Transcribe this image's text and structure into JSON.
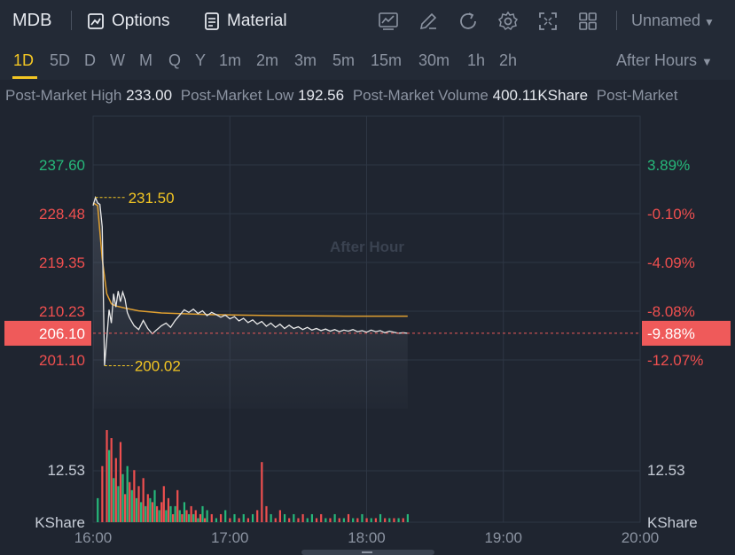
{
  "header": {
    "symbol": "MDB",
    "options_label": "Options",
    "material_label": "Material",
    "layout_name": "Unnamed"
  },
  "periods": {
    "items": [
      "1D",
      "5D",
      "D",
      "W",
      "M",
      "Q",
      "Y",
      "1m",
      "2m",
      "3m",
      "5m",
      "15m",
      "30m",
      "1h",
      "2h"
    ],
    "active": "1D",
    "session": "After Hours"
  },
  "stats": [
    {
      "label": "Post-Market High",
      "value": "233.00"
    },
    {
      "label": "Post-Market Low",
      "value": "192.56"
    },
    {
      "label": "Post-Market Volume",
      "value": "400.11KShare"
    },
    {
      "label": "Post-Market",
      "value": ""
    }
  ],
  "chart_data": {
    "type": "line",
    "watermark": "After Hour",
    "x_ticks": [
      "16:00",
      "17:00",
      "18:00",
      "19:00",
      "20:00"
    ],
    "price_axis": {
      "labels": [
        "237.60",
        "228.48",
        "219.35",
        "210.23",
        "201.10"
      ],
      "values": [
        237.6,
        228.48,
        219.35,
        210.23,
        201.1
      ]
    },
    "pct_axis": {
      "labels": [
        "3.89%",
        "-0.10%",
        "-4.09%",
        "-8.08%",
        "-12.07%"
      ]
    },
    "last_price": "206.10",
    "last_pct": "-9.88%",
    "high_marker": {
      "label": "231.50",
      "value": 231.5
    },
    "low_marker": {
      "label": "200.02",
      "value": 200.02
    },
    "volume_axis": {
      "label": "12.53",
      "unit": "KShare"
    },
    "price_series": {
      "x_minutes": [
        0,
        1,
        2,
        3,
        4,
        5,
        6,
        7,
        8,
        9,
        10,
        11,
        12,
        13,
        14,
        15,
        16,
        18,
        20,
        22,
        24,
        26,
        28,
        30,
        32,
        34,
        36,
        38,
        40,
        42,
        44,
        46,
        48,
        50,
        52,
        54,
        56,
        58,
        60,
        62,
        64,
        66,
        68,
        70,
        72,
        74,
        76,
        78,
        80,
        82,
        84,
        86,
        88,
        90,
        92,
        94,
        96,
        98,
        100,
        102,
        104,
        106,
        108,
        110,
        112,
        114,
        116,
        118,
        120,
        122,
        124,
        126,
        128,
        130,
        132,
        134,
        136,
        138
      ],
      "y_price": [
        230.0,
        231.5,
        230.5,
        230.2,
        226.0,
        200.02,
        205.0,
        210.5,
        208.0,
        213.5,
        211.0,
        214.0,
        212.0,
        213.8,
        212.5,
        210.0,
        209.0,
        207.5,
        206.8,
        208.5,
        207.0,
        206.0,
        206.8,
        207.5,
        208.0,
        207.2,
        208.5,
        209.5,
        210.5,
        210.0,
        210.6,
        209.8,
        210.3,
        209.4,
        210.0,
        209.6,
        209.1,
        209.5,
        208.8,
        209.2,
        208.4,
        208.9,
        208.1,
        208.6,
        207.8,
        208.3,
        207.4,
        208.0,
        207.2,
        207.8,
        207.0,
        207.6,
        207.0,
        207.3,
        206.8,
        207.2,
        206.7,
        207.0,
        206.6,
        206.9,
        206.5,
        206.8,
        206.4,
        206.7,
        206.5,
        206.8,
        206.4,
        206.6,
        206.3,
        206.7,
        206.4,
        206.6,
        206.2,
        206.5,
        206.3,
        206.1,
        206.2,
        206.1
      ]
    },
    "avg_series": {
      "x_minutes": [
        0,
        2,
        4,
        6,
        8,
        10,
        14,
        20,
        30,
        50,
        80,
        110,
        138
      ],
      "y_price": [
        230.5,
        230.0,
        220.0,
        213.5,
        211.6,
        211.2,
        210.8,
        210.3,
        209.9,
        209.6,
        209.4,
        209.3,
        209.3
      ]
    },
    "volume": [
      {
        "m": 2,
        "v": 6,
        "c": "g"
      },
      {
        "m": 4,
        "v": 14,
        "c": "r"
      },
      {
        "m": 6,
        "v": 23,
        "c": "r"
      },
      {
        "m": 7,
        "v": 18,
        "c": "g"
      },
      {
        "m": 8,
        "v": 21,
        "c": "r"
      },
      {
        "m": 9,
        "v": 11,
        "c": "g"
      },
      {
        "m": 10,
        "v": 16,
        "c": "r"
      },
      {
        "m": 11,
        "v": 9,
        "c": "g"
      },
      {
        "m": 12,
        "v": 20,
        "c": "r"
      },
      {
        "m": 13,
        "v": 12,
        "c": "g"
      },
      {
        "m": 14,
        "v": 7,
        "c": "r"
      },
      {
        "m": 15,
        "v": 14,
        "c": "g"
      },
      {
        "m": 16,
        "v": 10,
        "c": "r"
      },
      {
        "m": 17,
        "v": 8,
        "c": "g"
      },
      {
        "m": 18,
        "v": 13,
        "c": "r"
      },
      {
        "m": 19,
        "v": 6,
        "c": "g"
      },
      {
        "m": 20,
        "v": 9,
        "c": "r"
      },
      {
        "m": 21,
        "v": 5,
        "c": "g"
      },
      {
        "m": 22,
        "v": 11,
        "c": "r"
      },
      {
        "m": 23,
        "v": 4,
        "c": "g"
      },
      {
        "m": 24,
        "v": 7,
        "c": "r"
      },
      {
        "m": 25,
        "v": 6,
        "c": "g"
      },
      {
        "m": 26,
        "v": 5,
        "c": "r"
      },
      {
        "m": 27,
        "v": 8,
        "c": "g"
      },
      {
        "m": 28,
        "v": 4,
        "c": "r"
      },
      {
        "m": 29,
        "v": 3,
        "c": "g"
      },
      {
        "m": 30,
        "v": 5,
        "c": "r"
      },
      {
        "m": 31,
        "v": 9,
        "c": "r"
      },
      {
        "m": 32,
        "v": 3,
        "c": "g"
      },
      {
        "m": 33,
        "v": 6,
        "c": "r"
      },
      {
        "m": 34,
        "v": 4,
        "c": "g"
      },
      {
        "m": 35,
        "v": 2,
        "c": "r"
      },
      {
        "m": 36,
        "v": 4,
        "c": "g"
      },
      {
        "m": 37,
        "v": 8,
        "c": "r"
      },
      {
        "m": 38,
        "v": 3,
        "c": "g"
      },
      {
        "m": 39,
        "v": 2,
        "c": "r"
      },
      {
        "m": 40,
        "v": 5,
        "c": "g"
      },
      {
        "m": 41,
        "v": 3,
        "c": "r"
      },
      {
        "m": 42,
        "v": 2,
        "c": "g"
      },
      {
        "m": 43,
        "v": 4,
        "c": "r"
      },
      {
        "m": 44,
        "v": 2,
        "c": "g"
      },
      {
        "m": 45,
        "v": 3,
        "c": "r"
      },
      {
        "m": 46,
        "v": 1,
        "c": "g"
      },
      {
        "m": 47,
        "v": 2,
        "c": "r"
      },
      {
        "m": 48,
        "v": 4,
        "c": "g"
      },
      {
        "m": 49,
        "v": 1,
        "c": "r"
      },
      {
        "m": 50,
        "v": 3,
        "c": "g"
      },
      {
        "m": 52,
        "v": 2,
        "c": "r"
      },
      {
        "m": 54,
        "v": 1,
        "c": "g"
      },
      {
        "m": 56,
        "v": 2,
        "c": "r"
      },
      {
        "m": 58,
        "v": 3,
        "c": "g"
      },
      {
        "m": 60,
        "v": 1,
        "c": "r"
      },
      {
        "m": 62,
        "v": 2,
        "c": "g"
      },
      {
        "m": 64,
        "v": 1,
        "c": "r"
      },
      {
        "m": 66,
        "v": 2,
        "c": "g"
      },
      {
        "m": 68,
        "v": 1,
        "c": "r"
      },
      {
        "m": 70,
        "v": 2,
        "c": "g"
      },
      {
        "m": 72,
        "v": 3,
        "c": "r"
      },
      {
        "m": 74,
        "v": 15,
        "c": "r"
      },
      {
        "m": 76,
        "v": 4,
        "c": "r"
      },
      {
        "m": 78,
        "v": 2,
        "c": "g"
      },
      {
        "m": 80,
        "v": 1,
        "c": "r"
      },
      {
        "m": 82,
        "v": 3,
        "c": "r"
      },
      {
        "m": 84,
        "v": 2,
        "c": "g"
      },
      {
        "m": 86,
        "v": 1,
        "c": "r"
      },
      {
        "m": 88,
        "v": 2,
        "c": "g"
      },
      {
        "m": 90,
        "v": 1,
        "c": "r"
      },
      {
        "m": 92,
        "v": 2,
        "c": "r"
      },
      {
        "m": 94,
        "v": 1,
        "c": "g"
      },
      {
        "m": 96,
        "v": 2,
        "c": "g"
      },
      {
        "m": 98,
        "v": 1,
        "c": "r"
      },
      {
        "m": 100,
        "v": 2,
        "c": "r"
      },
      {
        "m": 102,
        "v": 1,
        "c": "g"
      },
      {
        "m": 104,
        "v": 1,
        "c": "r"
      },
      {
        "m": 106,
        "v": 2,
        "c": "g"
      },
      {
        "m": 108,
        "v": 1,
        "c": "r"
      },
      {
        "m": 110,
        "v": 1,
        "c": "g"
      },
      {
        "m": 112,
        "v": 2,
        "c": "r"
      },
      {
        "m": 114,
        "v": 1,
        "c": "g"
      },
      {
        "m": 116,
        "v": 1,
        "c": "r"
      },
      {
        "m": 118,
        "v": 2,
        "c": "g"
      },
      {
        "m": 120,
        "v": 1,
        "c": "r"
      },
      {
        "m": 122,
        "v": 1,
        "c": "g"
      },
      {
        "m": 124,
        "v": 1,
        "c": "r"
      },
      {
        "m": 126,
        "v": 2,
        "c": "g"
      },
      {
        "m": 128,
        "v": 1,
        "c": "r"
      },
      {
        "m": 130,
        "v": 1,
        "c": "g"
      },
      {
        "m": 132,
        "v": 1,
        "c": "r"
      },
      {
        "m": 134,
        "v": 1,
        "c": "g"
      },
      {
        "m": 136,
        "v": 1,
        "c": "r"
      },
      {
        "m": 138,
        "v": 2,
        "c": "g"
      }
    ],
    "colors": {
      "up": "#26b87a",
      "down": "#ef4f4f",
      "price_line": "#e8e8e8",
      "avg_line": "#e0a030",
      "marker": "#f3c623",
      "last_price_bg": "#ef5a5a",
      "grid": "#2e3644"
    }
  }
}
